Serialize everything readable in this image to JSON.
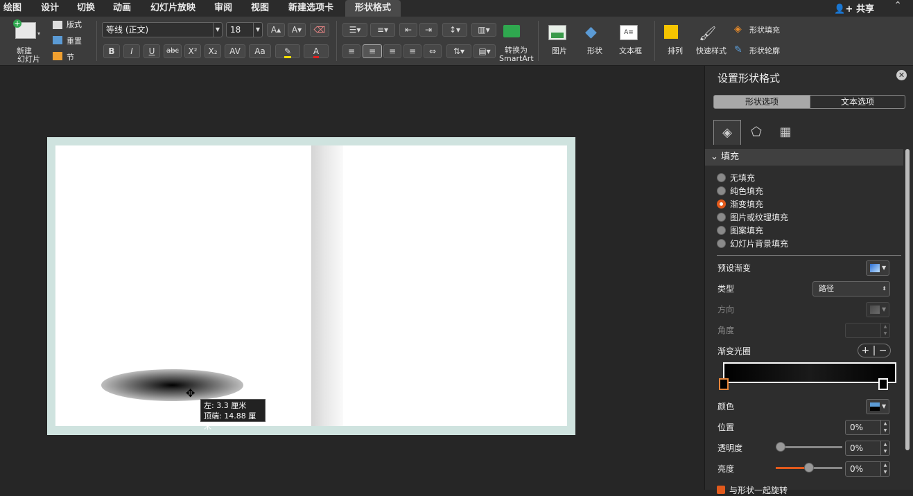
{
  "tabs": [
    "绘图",
    "设计",
    "切换",
    "动画",
    "幻灯片放映",
    "审阅",
    "视图",
    "新建选项卡",
    "形状格式"
  ],
  "active_tab": "形状格式",
  "share": "共享",
  "ribbon": {
    "new_slide": [
      "新建",
      "幻灯片"
    ],
    "layout": "版式",
    "reset": "重置",
    "section": "节",
    "font_name": "等线 (正文)",
    "font_size": "18",
    "convert_smartart": [
      "转换为",
      "SmartArt"
    ],
    "picture": "图片",
    "shapes": "形状",
    "textbox": "文本框",
    "arrange": "排列",
    "quick_styles": "快速样式",
    "shape_fill": "形状填充",
    "shape_outline": "形状轮廓",
    "bold": "B",
    "italic": "I",
    "underline": "U",
    "strike": "abc",
    "superscript": "X²",
    "subscript": "X₂",
    "char_spacing": "AV",
    "change_case": "Aa"
  },
  "tooltip": {
    "left": "左: 3.3 厘米",
    "top": "顶端: 14.88 厘米"
  },
  "panel": {
    "title": "设置形状格式",
    "seg_shape": "形状选项",
    "seg_text": "文本选项",
    "section": "填充",
    "fill_options": [
      "无填充",
      "纯色填充",
      "渐变填充",
      "图片或纹理填充",
      "图案填充",
      "幻灯片背景填充"
    ],
    "selected_fill": "渐变填充",
    "preset_gradient": "预设渐变",
    "type_label": "类型",
    "type_value": "路径",
    "direction": "方向",
    "angle": "角度",
    "gradient_stops": "渐变光圈",
    "color": "颜色",
    "position": "位置",
    "position_value": "0%",
    "transparency": "透明度",
    "transparency_value": "0%",
    "brightness": "亮度",
    "brightness_value": "0%",
    "rotate_with_shape": "与形状一起旋转"
  },
  "colors": {
    "accent": "#e25a1c",
    "slide_border": "#cfe3df",
    "panel_bg": "#2d2d2d"
  }
}
